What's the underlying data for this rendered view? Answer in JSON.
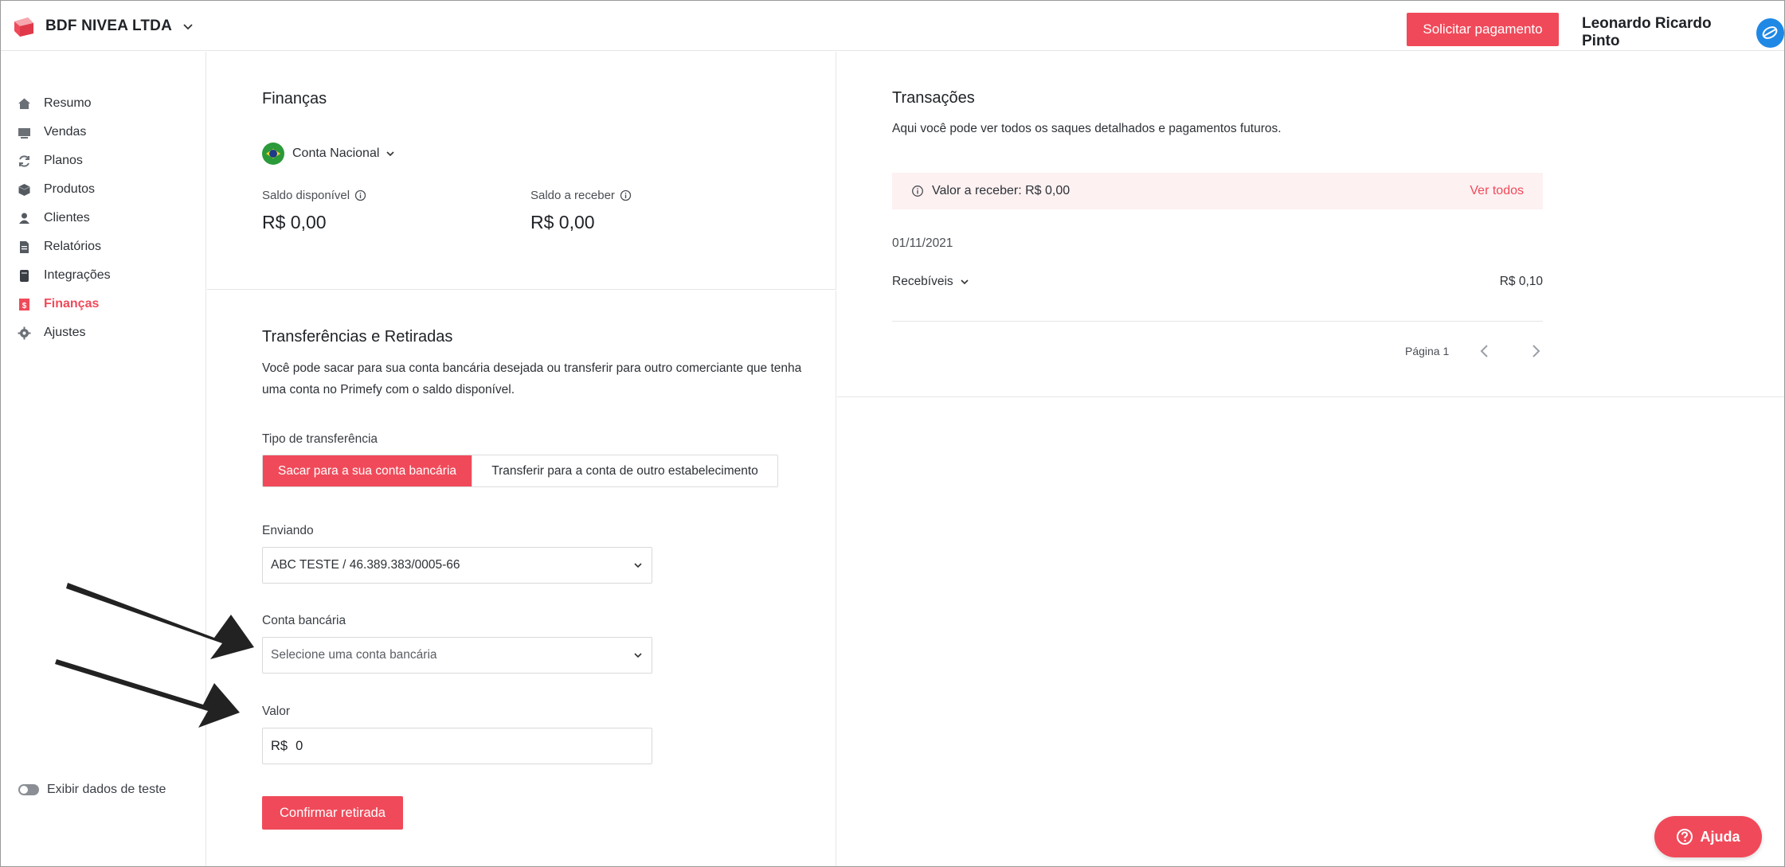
{
  "header": {
    "company_name": "BDF NIVEA LTDA",
    "request_payment_label": "Solicitar pagamento",
    "user_name": "Leonardo Ricardo Pinto"
  },
  "sidebar": {
    "items": [
      {
        "label": "Resumo",
        "icon": "home-icon"
      },
      {
        "label": "Vendas",
        "icon": "sales-icon"
      },
      {
        "label": "Planos",
        "icon": "refresh-icon"
      },
      {
        "label": "Produtos",
        "icon": "box-icon"
      },
      {
        "label": "Clientes",
        "icon": "users-icon"
      },
      {
        "label": "Relatórios",
        "icon": "document-icon"
      },
      {
        "label": "Integrações",
        "icon": "integration-icon"
      },
      {
        "label": "Finanças",
        "icon": "finance-icon",
        "active": true
      },
      {
        "label": "Ajustes",
        "icon": "gear-icon"
      }
    ],
    "test_data_label": "Exibir dados de teste"
  },
  "finance": {
    "title": "Finanças",
    "account_label": "Conta Nacional",
    "available_label": "Saldo disponível",
    "available_value": "R$ 0,00",
    "receivable_label": "Saldo a receber",
    "receivable_value": "R$ 0,00"
  },
  "transfers": {
    "title": "Transferências e Retiradas",
    "description": "Você pode sacar para sua conta bancária desejada ou transferir para outro comerciante que tenha uma conta no Primefy com o saldo disponível.",
    "type_label": "Tipo de transferência",
    "type_option_bank": "Sacar para a sua conta bancária",
    "type_option_other": "Transferir para a conta de outro estabelecimento",
    "sending_label": "Enviando",
    "sending_value": "ABC TESTE / 46.389.383/0005-66",
    "bank_account_label": "Conta bancária",
    "bank_account_placeholder": "Selecione uma conta bancária",
    "amount_label": "Valor",
    "amount_prefix": "R$",
    "amount_value": "0",
    "confirm_label": "Confirmar retirada"
  },
  "transactions": {
    "title": "Transações",
    "description": "Aqui você pode ver todos os saques detalhados e pagamentos futuros.",
    "receivable_text": "Valor a receber: R$ 0,00",
    "see_all_label": "Ver todos",
    "date": "01/11/2021",
    "row_category": "Recebíveis",
    "row_amount": "R$ 0,10",
    "page_label": "Página 1"
  },
  "help": {
    "label": "Ajuda"
  },
  "colors": {
    "accent": "#f04a5a",
    "avatar": "#1f88e5",
    "receivable_bg": "#fdf1f2"
  }
}
